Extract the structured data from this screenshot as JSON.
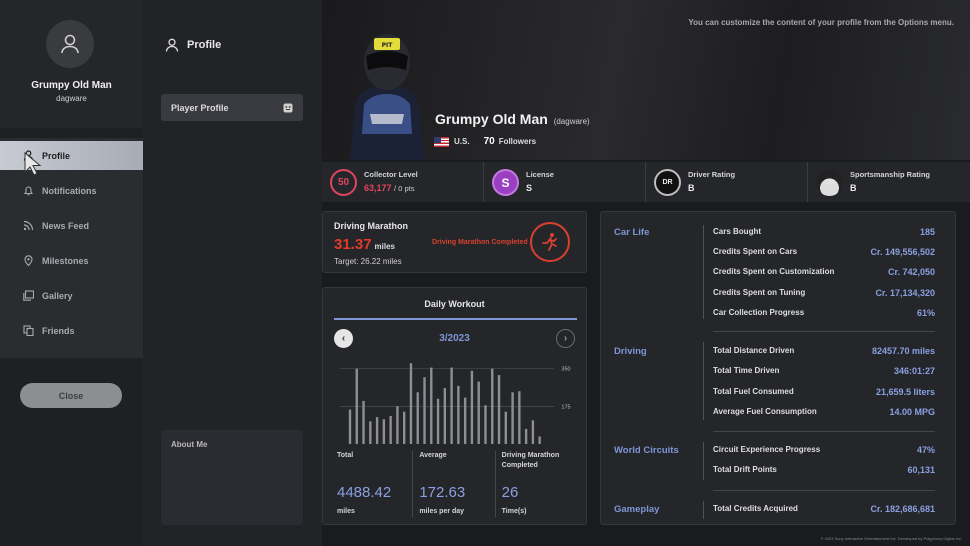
{
  "sidebar": {
    "user_name": "Grumpy Old Man",
    "user_handle": "dagware",
    "items": [
      {
        "label": "Profile",
        "icon": "person-icon"
      },
      {
        "label": "Notifications",
        "icon": "bell-icon"
      },
      {
        "label": "News Feed",
        "icon": "rss-icon"
      },
      {
        "label": "Milestones",
        "icon": "pin-icon"
      },
      {
        "label": "Gallery",
        "icon": "gallery-icon"
      },
      {
        "label": "Friends",
        "icon": "friends-icon"
      }
    ],
    "close_label": "Close"
  },
  "middle": {
    "title": "Profile",
    "player_profile_label": "Player Profile",
    "about_me_label": "About Me"
  },
  "banner": {
    "hint": "You can customize the content of your profile from the Options menu.",
    "name": "Grumpy Old Man",
    "handle": "(dagware)",
    "country": "U.S.",
    "followers_count": "70",
    "followers_label": "Followers"
  },
  "stats_strip": {
    "collector": {
      "badge": "50",
      "label": "Collector Level",
      "value_red": "63,177",
      "value_rest": "/ 0 pts"
    },
    "license": {
      "badge": "S",
      "label": "License",
      "value": "S"
    },
    "driver_rating": {
      "badge": "DR",
      "label": "Driver Rating",
      "value": "B"
    },
    "sportsmanship": {
      "badge": "SR",
      "label": "Sportsmanship Rating",
      "value": "B"
    }
  },
  "marathon": {
    "title": "Driving Marathon",
    "value": "31.37",
    "unit": "miles",
    "target": "Target: 26.22 miles",
    "status": "Driving Marathon Completed"
  },
  "workout": {
    "title": "Daily Workout",
    "month": "3/2023",
    "stats": [
      {
        "header": "Total",
        "value": "4488.42",
        "unit": "miles"
      },
      {
        "header": "Average",
        "value": "172.63",
        "unit": "miles per day"
      },
      {
        "header": "Driving Marathon Completed",
        "value": "26",
        "unit": "Time(s)"
      }
    ]
  },
  "chart_data": {
    "type": "bar",
    "yticks": [
      "350",
      "175"
    ],
    "ylim": [
      0,
      390
    ],
    "values": [
      0,
      160,
      350,
      200,
      105,
      125,
      115,
      130,
      175,
      150,
      375,
      240,
      310,
      355,
      210,
      260,
      355,
      270,
      215,
      340,
      290,
      180,
      350,
      320,
      150,
      240,
      245,
      70,
      110,
      35,
      0
    ],
    "bar_color": "#8e8f94"
  },
  "right_panel": {
    "sections": [
      {
        "name": "Car Life",
        "rows": [
          {
            "k": "Cars Bought",
            "v": "185"
          },
          {
            "k": "Credits Spent on Cars",
            "v": "Cr. 149,556,502"
          },
          {
            "k": "Credits Spent on Customization",
            "v": "Cr. 742,050"
          },
          {
            "k": "Credits Spent on Tuning",
            "v": "Cr. 17,134,320"
          },
          {
            "k": "Car Collection Progress",
            "v": "61%"
          }
        ]
      },
      {
        "name": "Driving",
        "rows": [
          {
            "k": "Total Distance Driven",
            "v": "82457.70 miles"
          },
          {
            "k": "Total Time Driven",
            "v": "346:01:27"
          },
          {
            "k": "Total Fuel Consumed",
            "v": "21,659.5 liters"
          },
          {
            "k": "Average Fuel Consumption",
            "v": "14.00 MPG"
          }
        ]
      },
      {
        "name": "World Circuits",
        "rows": [
          {
            "k": "Circuit Experience Progress",
            "v": "47%"
          },
          {
            "k": "Total Drift Points",
            "v": "60,131"
          }
        ]
      },
      {
        "name": "Gameplay",
        "rows": [
          {
            "k": "Total Credits Acquired",
            "v": "Cr. 182,686,681"
          }
        ]
      }
    ]
  },
  "legal": "© 2023 Sony Interactive Entertainment Inc. Developed by Polyphony Digital Inc.",
  "colors": {
    "accent": "#7f96d6",
    "red": "#e33a2c",
    "collector": "#e0455e",
    "license": "#9b3fc2"
  }
}
